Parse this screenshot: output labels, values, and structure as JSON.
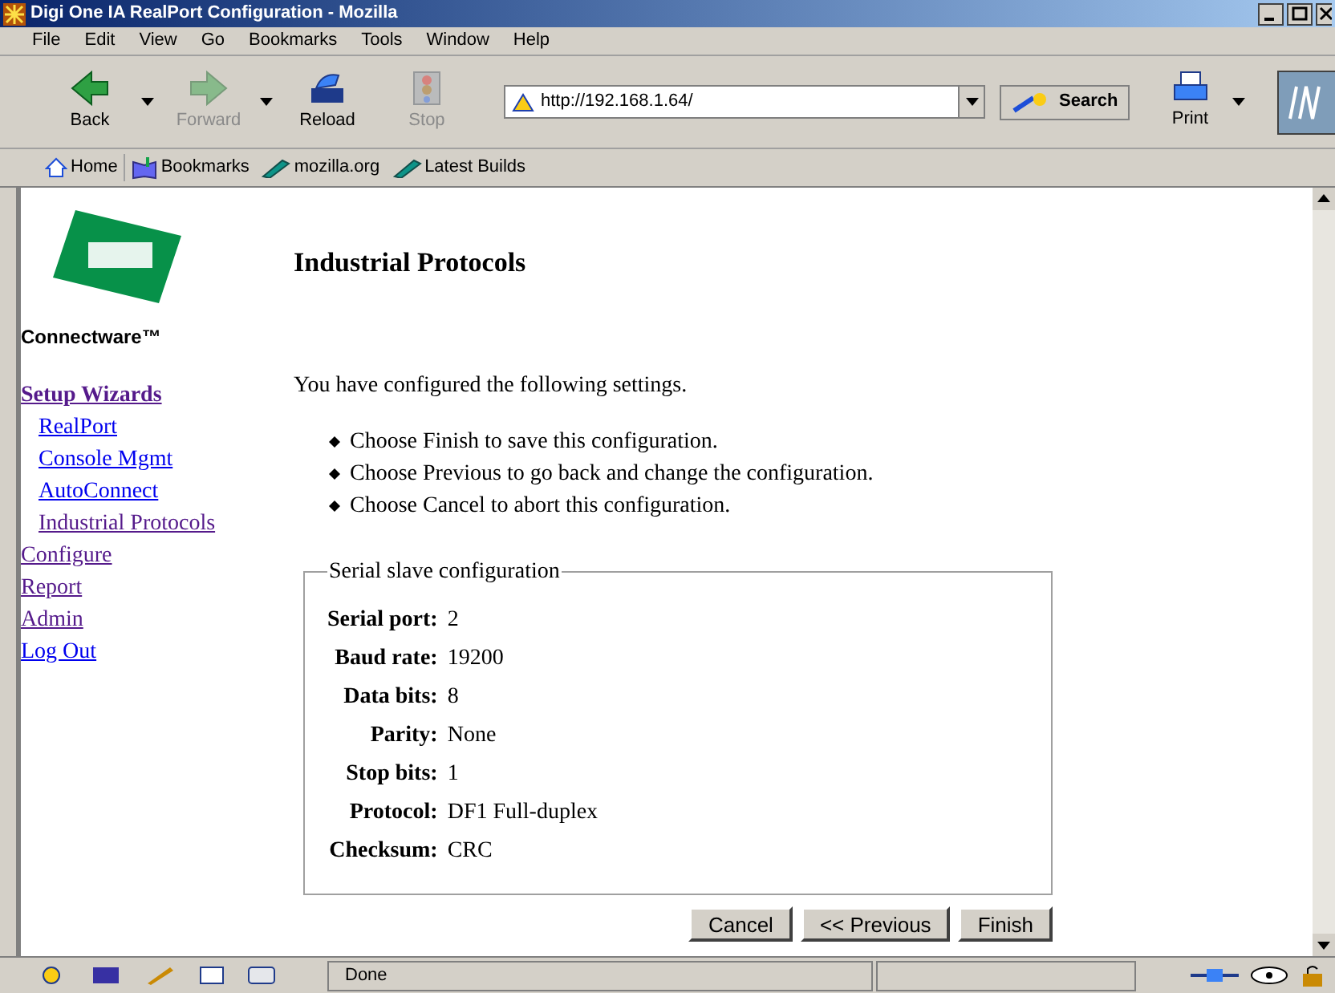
{
  "window": {
    "title": "Digi One IA RealPort Configuration - Mozilla"
  },
  "menu": [
    "File",
    "Edit",
    "View",
    "Go",
    "Bookmarks",
    "Tools",
    "Window",
    "Help"
  ],
  "toolbar": [
    {
      "kind": "back",
      "label": "Back",
      "disabled": false,
      "dropdown": true
    },
    {
      "kind": "forward",
      "label": "Forward",
      "disabled": true,
      "dropdown": true
    },
    {
      "kind": "reload",
      "label": "Reload",
      "disabled": false,
      "dropdown": false
    },
    {
      "kind": "stop",
      "label": "Stop",
      "disabled": true,
      "dropdown": false
    }
  ],
  "address": {
    "value": "http://192.168.1.64/"
  },
  "search_button": "Search",
  "print_button": "Print",
  "personal_toolbar": [
    {
      "kind": "home",
      "label": "Home"
    },
    {
      "kind": "bookmarks",
      "label": "Bookmarks"
    },
    {
      "kind": "link",
      "label": "mozilla.org"
    },
    {
      "kind": "link",
      "label": "Latest Builds"
    }
  ],
  "sidebar": {
    "brand": "Connectware™",
    "items": [
      {
        "label": "Setup Wizards",
        "visited": true,
        "children": [
          {
            "label": "RealPort",
            "visited": false
          },
          {
            "label": "Console Mgmt",
            "visited": false
          },
          {
            "label": "AutoConnect",
            "visited": false
          },
          {
            "label": "Industrial Protocols",
            "visited": true
          }
        ]
      },
      {
        "label": "Configure",
        "visited": true
      },
      {
        "label": "Report",
        "visited": true
      },
      {
        "label": "Admin",
        "visited": true
      },
      {
        "label": "Log Out",
        "visited": false
      }
    ]
  },
  "page": {
    "heading": "Industrial Protocols",
    "intro": "You have configured the following settings.",
    "bullets": [
      "Choose Finish to save this configuration.",
      "Choose Previous to go back and change the configuration.",
      "Choose Cancel to abort this configuration."
    ],
    "fieldset": {
      "legend": "Serial slave configuration",
      "rows": [
        {
          "label": "Serial port:",
          "value": "2"
        },
        {
          "label": "Baud rate:",
          "value": "19200"
        },
        {
          "label": "Data bits:",
          "value": "8"
        },
        {
          "label": "Parity:",
          "value": "None"
        },
        {
          "label": "Stop bits:",
          "value": "1"
        },
        {
          "label": "Protocol:",
          "value": "DF1 Full-duplex"
        },
        {
          "label": "Checksum:",
          "value": "CRC"
        }
      ]
    },
    "buttons": [
      "Cancel",
      "<< Previous",
      "Finish"
    ]
  },
  "status_bar": {
    "text": "Done"
  }
}
